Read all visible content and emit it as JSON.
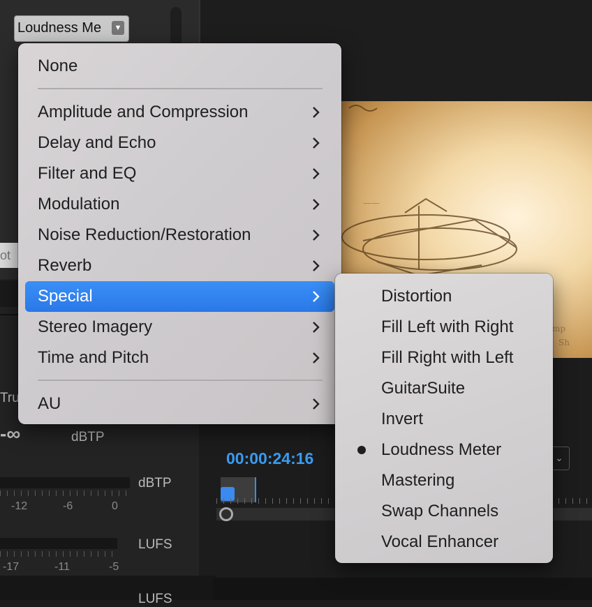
{
  "effect_slot": {
    "value": "Loudness Me"
  },
  "background": {
    "input_fragment": "ot",
    "true_peak_fragment": "Tru",
    "minus_infinity": "-∞",
    "unit_dbtp_1": "dBTP",
    "unit_dbtp_2": "dBTP",
    "unit_lufs_1": "LUFS",
    "unit_lufs_2": "LUFS",
    "dbtp_scale": [
      "-12",
      "-6",
      "0"
    ],
    "lufs_scale": [
      "-17",
      "-11",
      "-5"
    ],
    "timecode": "00:00:24:16"
  },
  "menu": {
    "top_item": "None",
    "items": [
      {
        "label": "Amplitude and Compression"
      },
      {
        "label": "Delay and Echo"
      },
      {
        "label": "Filter and EQ"
      },
      {
        "label": "Modulation"
      },
      {
        "label": "Noise Reduction/Restoration"
      },
      {
        "label": "Reverb"
      },
      {
        "label": "Special"
      },
      {
        "label": "Stereo Imagery"
      },
      {
        "label": "Time and Pitch"
      }
    ],
    "bottom_item": "AU",
    "active_index": 6
  },
  "submenu": {
    "items": [
      {
        "label": "Distortion"
      },
      {
        "label": "Fill Left with Right"
      },
      {
        "label": "Fill Right with Left"
      },
      {
        "label": "GuitarSuite"
      },
      {
        "label": "Invert"
      },
      {
        "label": "Loudness Meter",
        "selected": true
      },
      {
        "label": "Mastering"
      },
      {
        "label": "Swap Channels"
      },
      {
        "label": "Vocal Enhancer"
      }
    ]
  },
  "colors": {
    "accent": "#2a7fe8",
    "timecode": "#3a9bf0"
  }
}
